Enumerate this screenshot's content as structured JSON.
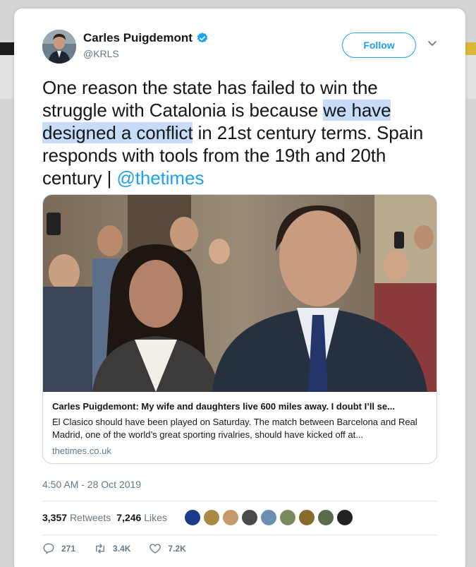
{
  "tweet": {
    "author": {
      "display_name": "Carles Puigdemont",
      "handle": "@KRLS",
      "verified": true,
      "avatar_icon": "avatar-photo"
    },
    "follow_label": "Follow",
    "text": {
      "part1": "One reason the state has failed to win the struggle with Catalonia is because ",
      "highlight": "we have designed a conflict",
      "part2": " in 21st century terms. Spain responds with tools from the 19th and 20th century | ",
      "mention": "@thetimes"
    },
    "link_card": {
      "title": "Carles Puigdemont: My wife and daughters live 600 miles away. I doubt I’ll se...",
      "description": "El Clasico should have been played on Saturday. The match between Barcelona and Real Madrid, one of the world’s great sporting rivalries, should have kicked off at...",
      "domain": "thetimes.co.uk"
    },
    "timestamp": "4:50 AM - 28 Oct 2019",
    "stats": {
      "retweets_count": "3,357",
      "retweets_label": "Retweets",
      "likes_count": "7,246",
      "likes_label": "Likes"
    },
    "actions": {
      "reply_count": "271",
      "retweet_count": "3.4K",
      "like_count": "7.2K"
    },
    "facepile": [
      "#1a3a8a",
      "#a88a44",
      "#c49a6c",
      "#4a4a4a",
      "#6b8fb0",
      "#7a8a5a",
      "#8a6a2a",
      "#5a6a4a",
      "#222222"
    ],
    "colors": {
      "accent": "#1da1f2",
      "highlight": "#c6dcf8",
      "text": "#14171a",
      "muted": "#657786"
    }
  }
}
